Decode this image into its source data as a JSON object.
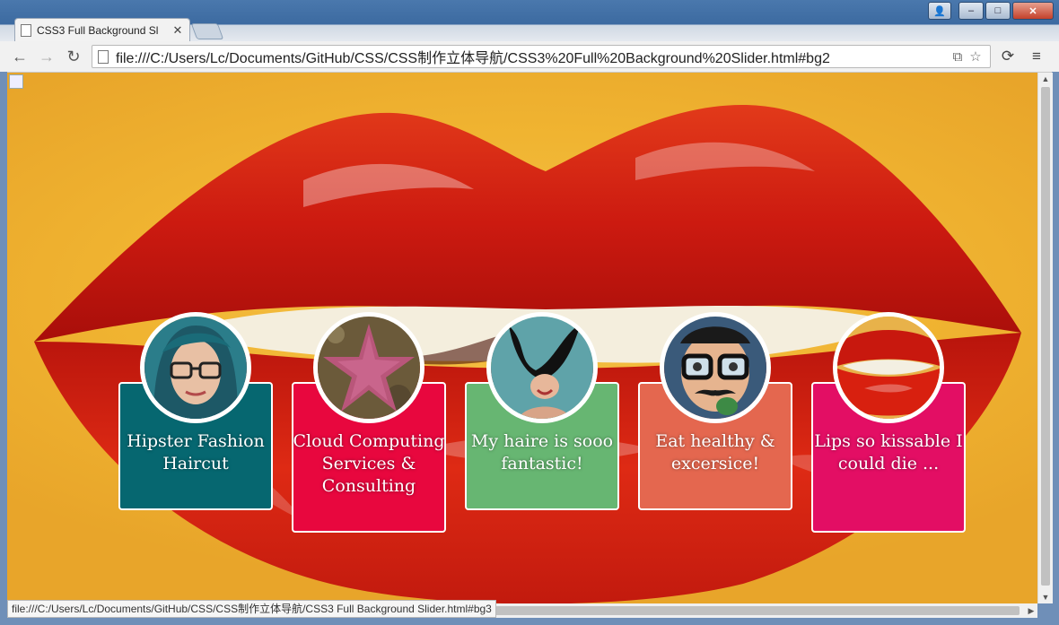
{
  "tab": {
    "title": "CSS3 Full Background Sl",
    "close": "✕"
  },
  "window": {
    "minimize": "–",
    "maximize": "□",
    "close": "✕",
    "user": "👤"
  },
  "toolbar": {
    "back": "←",
    "forward": "→",
    "reload": "↻",
    "url": "file:///C:/Users/Lc/Documents/GitHub/CSS/CSS制作立体导航/CSS3%20Full%20Background%20Slider.html#bg2",
    "translate_icon": "⧉",
    "star_icon": "☆",
    "sync_icon": "⟳",
    "menu_icon": "≡"
  },
  "status": {
    "text": "file:///C:/Users/Lc/Documents/GitHub/CSS/CSS制作立体导航/CSS3 Full Background Slider.html#bg3"
  },
  "slides": [
    {
      "label": "Hipster Fashion Haircut",
      "color": "#066770",
      "avatar": "woman-with-glasses"
    },
    {
      "label": "Cloud Computing Services & Consulting",
      "color": "#e8073e",
      "avatar": "starfish"
    },
    {
      "label": "My haire is sooo fantastic!",
      "color": "#67b672",
      "avatar": "woman-hair-flying"
    },
    {
      "label": "Eat healthy & excersice!",
      "color": "#e4674f",
      "avatar": "man-with-glasses-mustache"
    },
    {
      "label": "Lips so kissable I could die ...",
      "color": "#e30e64",
      "avatar": "lips-closeup"
    }
  ]
}
